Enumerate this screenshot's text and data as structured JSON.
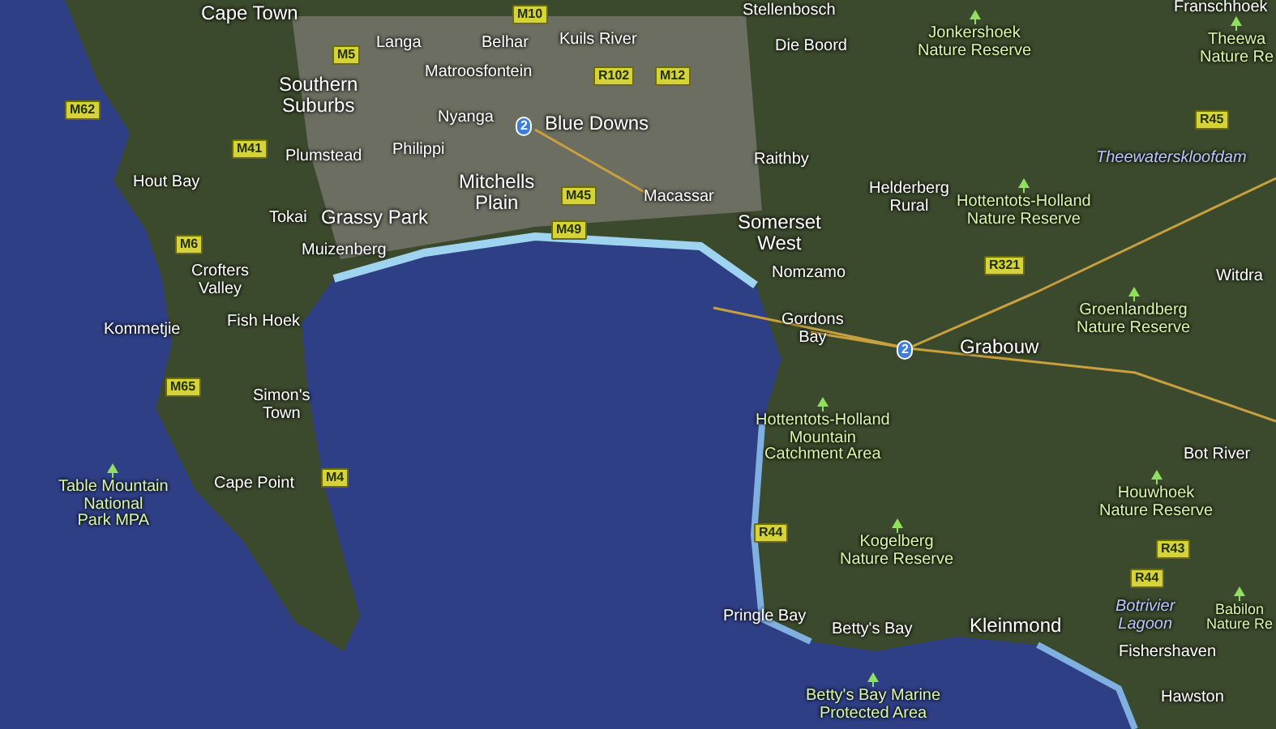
{
  "places": [
    {
      "kind": "city",
      "text": "Cape Town"
    },
    {
      "kind": "town",
      "text": "Stellenbosch"
    },
    {
      "kind": "town",
      "text": "Franschhoek"
    },
    {
      "kind": "town",
      "text": "Langa"
    },
    {
      "kind": "town",
      "text": "Belhar"
    },
    {
      "kind": "town",
      "text": "Kuils River"
    },
    {
      "kind": "town",
      "text": "Die Boord"
    },
    {
      "kind": "city",
      "text": "Southern\nSuburbs"
    },
    {
      "kind": "town",
      "text": "Matroosfontein"
    },
    {
      "kind": "town",
      "text": "Nyanga"
    },
    {
      "kind": "city",
      "text": "Blue Downs"
    },
    {
      "kind": "town",
      "text": "Plumstead"
    },
    {
      "kind": "town",
      "text": "Philippi"
    },
    {
      "kind": "town",
      "text": "Raithby"
    },
    {
      "kind": "town",
      "text": "Hout Bay"
    },
    {
      "kind": "town",
      "text": "Tokai"
    },
    {
      "kind": "city",
      "text": "Grassy Park"
    },
    {
      "kind": "city",
      "text": "Mitchells\nPlain"
    },
    {
      "kind": "town",
      "text": "Macassar"
    },
    {
      "kind": "town",
      "text": "Helderberg\nRural"
    },
    {
      "kind": "city",
      "text": "Somerset\nWest"
    },
    {
      "kind": "town",
      "text": "Crofters\nValley"
    },
    {
      "kind": "town",
      "text": "Muizenberg"
    },
    {
      "kind": "town",
      "text": "Nomzamo"
    },
    {
      "kind": "town",
      "text": "Kommetjie"
    },
    {
      "kind": "town",
      "text": "Fish Hoek"
    },
    {
      "kind": "town",
      "text": "Gordons\nBay"
    },
    {
      "kind": "city",
      "text": "Grabouw"
    },
    {
      "kind": "town",
      "text": "Simon's\nTown"
    },
    {
      "kind": "town",
      "text": "Cape Point"
    },
    {
      "kind": "town",
      "text": "Bot River"
    },
    {
      "kind": "town",
      "text": "Pringle Bay"
    },
    {
      "kind": "town",
      "text": "Betty's Bay"
    },
    {
      "kind": "city",
      "text": "Kleinmond"
    },
    {
      "kind": "town",
      "text": "Fishershaven"
    },
    {
      "kind": "town",
      "text": "Hawston"
    },
    {
      "kind": "town",
      "text": "Witdra"
    },
    {
      "kind": "reserve",
      "text": "Jonkershoek\nNature Reserve"
    },
    {
      "kind": "reserve",
      "text": "Theewa\nNature Re"
    },
    {
      "kind": "reserve",
      "text": "Hottentots-Holland\nNature Reserve"
    },
    {
      "kind": "reserve",
      "text": "Groenlandberg\nNature Reserve"
    },
    {
      "kind": "reserve",
      "text": "Hottentots-Holland\nMountain\nCatchment Area"
    },
    {
      "kind": "reserve",
      "text": "Table Mountain\nNational\nPark MPA"
    },
    {
      "kind": "reserve",
      "text": "Houwhoek\nNature Reserve"
    },
    {
      "kind": "reserve",
      "text": "Kogelberg\nNature Reserve"
    },
    {
      "kind": "reserve",
      "text": "Babilon\nNature Re"
    },
    {
      "kind": "reserve",
      "text": "Betty's Bay Marine\nProtected Area"
    },
    {
      "kind": "water",
      "text": "Theewaterskloofdam"
    },
    {
      "kind": "water",
      "text": "Botrivier\nLagoon"
    }
  ],
  "roads": [
    {
      "kind": "regional",
      "label": "M62"
    },
    {
      "kind": "regional",
      "label": "M5"
    },
    {
      "kind": "regional",
      "label": "M10"
    },
    {
      "kind": "regional",
      "label": "R102"
    },
    {
      "kind": "regional",
      "label": "M12"
    },
    {
      "kind": "regional",
      "label": "M41"
    },
    {
      "kind": "regional",
      "label": "M45"
    },
    {
      "kind": "regional",
      "label": "M49"
    },
    {
      "kind": "regional",
      "label": "M6"
    },
    {
      "kind": "regional",
      "label": "M65"
    },
    {
      "kind": "regional",
      "label": "M4"
    },
    {
      "kind": "regional",
      "label": "R44"
    },
    {
      "kind": "regional",
      "label": "R45"
    },
    {
      "kind": "regional",
      "label": "R321"
    },
    {
      "kind": "regional",
      "label": "R43"
    },
    {
      "kind": "regional",
      "label": "R44"
    },
    {
      "kind": "national",
      "label": "2"
    },
    {
      "kind": "national",
      "label": "2"
    }
  ]
}
